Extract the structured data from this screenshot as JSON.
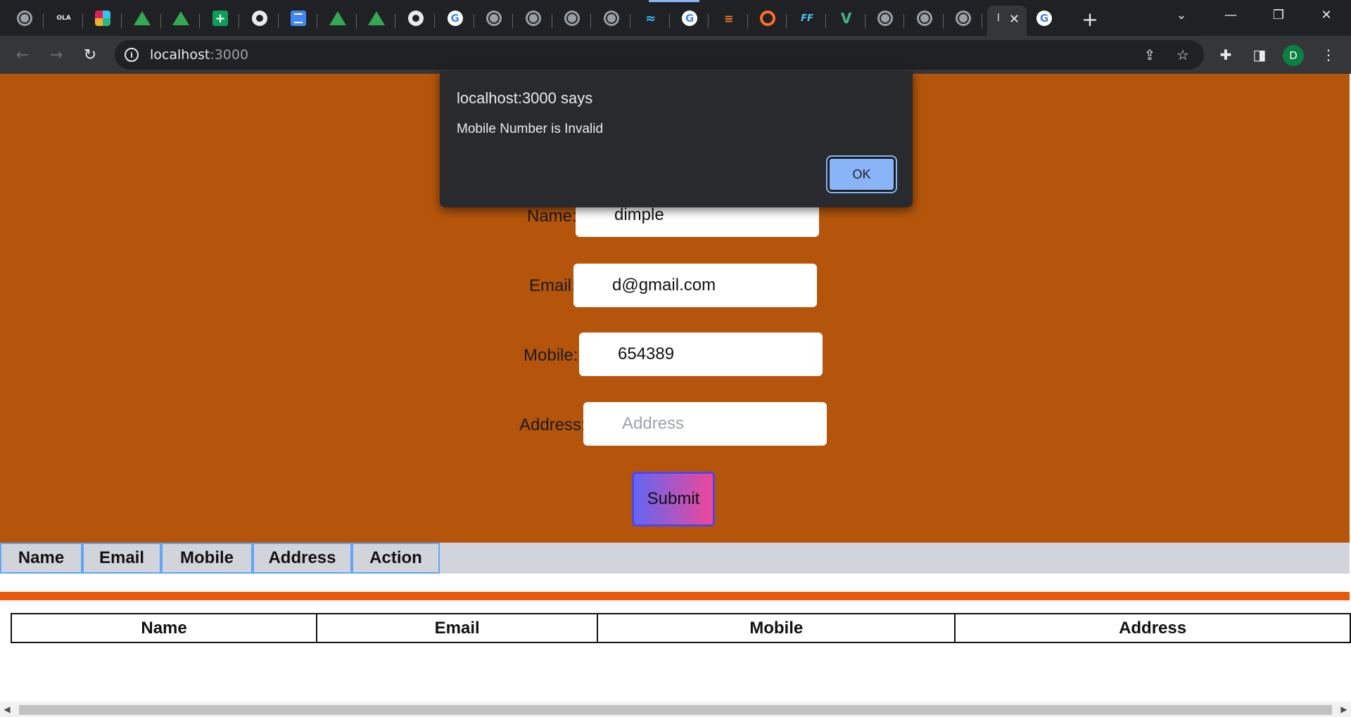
{
  "browser": {
    "tabs": [
      {
        "icon": "globe-icon",
        "glyph": ""
      },
      {
        "icon": "ola-icon",
        "glyph": "OLA"
      },
      {
        "icon": "slack-icon",
        "glyph": ""
      },
      {
        "icon": "google-drive-icon",
        "glyph": ""
      },
      {
        "icon": "google-drive-icon",
        "glyph": ""
      },
      {
        "icon": "google-sheets-icon",
        "glyph": "+"
      },
      {
        "icon": "github-icon",
        "glyph": ""
      },
      {
        "icon": "google-docs-icon",
        "glyph": ""
      },
      {
        "icon": "google-drive-icon",
        "glyph": ""
      },
      {
        "icon": "google-drive-icon",
        "glyph": ""
      },
      {
        "icon": "github-icon",
        "glyph": ""
      },
      {
        "icon": "google-icon",
        "glyph": "G"
      },
      {
        "icon": "globe-icon",
        "glyph": ""
      },
      {
        "icon": "globe-icon",
        "glyph": ""
      },
      {
        "icon": "globe-icon",
        "glyph": ""
      },
      {
        "icon": "globe-icon",
        "glyph": ""
      },
      {
        "icon": "tailwind-icon",
        "glyph": "≈"
      },
      {
        "icon": "google-icon",
        "glyph": "G"
      },
      {
        "icon": "stackoverflow-icon",
        "glyph": "≡"
      },
      {
        "icon": "ring-icon",
        "glyph": ""
      },
      {
        "icon": "ff-icon",
        "glyph": "FF"
      },
      {
        "icon": "vue-icon",
        "glyph": "V"
      },
      {
        "icon": "globe-icon",
        "glyph": ""
      },
      {
        "icon": "globe-icon",
        "glyph": ""
      },
      {
        "icon": "globe-icon",
        "glyph": ""
      }
    ],
    "active_tab_title": "l",
    "after_active_tab": {
      "icon": "google-icon",
      "glyph": "G"
    },
    "close_glyph": "✕",
    "newtab_glyph": "+",
    "tab_search_glyph": "⌄",
    "minimize_glyph": "—",
    "restore_glyph": "❐",
    "window_close_glyph": "✕",
    "back_glyph": "←",
    "forward_glyph": "→",
    "reload_glyph": "↻",
    "url_host": "localhost",
    "url_port": ":3000",
    "info_glyph": "i",
    "share_glyph": "⇪",
    "star_glyph": "☆",
    "extensions_glyph": "✚",
    "sidepanel_glyph": "◨",
    "profile_initial": "D",
    "menu_glyph": "⋮"
  },
  "form": {
    "name_label": "Name:",
    "name_value": "dimple",
    "email_label": "Email:",
    "email_value": "d@gmail.com",
    "mobile_label": "Mobile:",
    "mobile_value": "654389",
    "address_label": "Address:",
    "address_placeholder": "Address",
    "address_value": "",
    "submit_label": "Submit"
  },
  "header_table": {
    "columns": [
      "Name",
      "Email",
      "Mobile",
      "Address",
      "Action"
    ]
  },
  "data_table": {
    "columns": [
      "Name",
      "Email",
      "Mobile",
      "Address"
    ]
  },
  "dialog": {
    "title": "localhost:3000 says",
    "message": "Mobile Number is Invalid",
    "ok_label": "OK"
  },
  "scrollbar": {
    "left_arrow": "◀",
    "right_arrow": "▶"
  },
  "colors": {
    "form_background": "#b5550b",
    "orange_line": "#ea580c",
    "header_border": "#60a5fa",
    "dialog_background": "#292a2d",
    "ok_button": "#8ab4f8"
  }
}
